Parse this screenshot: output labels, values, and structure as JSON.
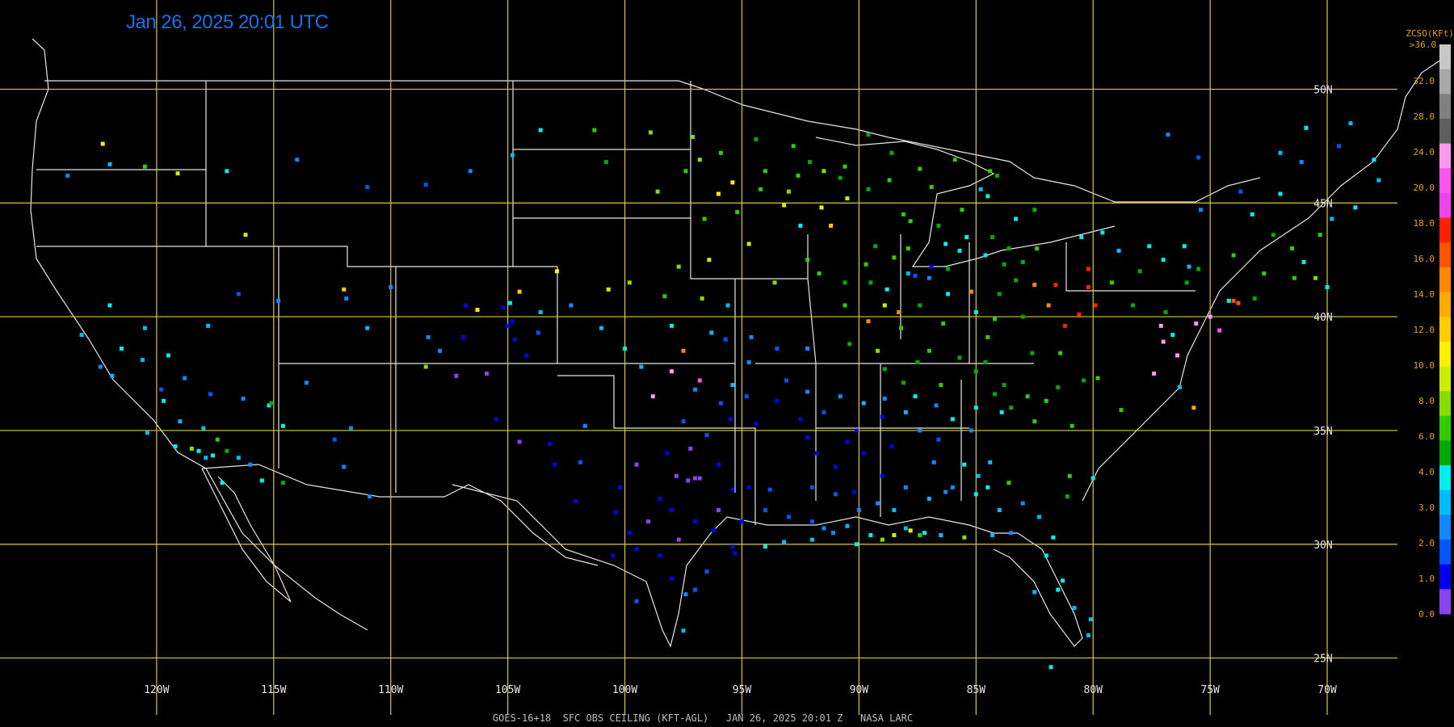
{
  "title": "Jan 26, 2025 20:01 UTC",
  "footer": "GOES-16+18  SFC OBS CEILING (KFT-AGL)   JAN 26, 2025 20:01 Z   NASA LARC",
  "colors": {
    "grid": "#d4c84a",
    "coast": "#e6e6e6",
    "title": "#1e6ee6",
    "legend_text": "#e0a020"
  },
  "map": {
    "lon_min": -126,
    "lon_max": -67,
    "lat_min": 22.5,
    "lat_max": 52.5,
    "grid_lons": [
      -120,
      -115,
      -110,
      -105,
      -100,
      -95,
      -90,
      -85,
      -80,
      -75,
      -70
    ],
    "grid_lats": [
      25,
      30,
      35,
      40,
      45,
      50
    ],
    "lon_labels": [
      "120W",
      "115W",
      "110W",
      "105W",
      "100W",
      "95W",
      "90W",
      "85W",
      "80W",
      "75W",
      "70W"
    ],
    "lat_labels": [
      "25N",
      "30N",
      "35N",
      "40N",
      "45N",
      "50N"
    ]
  },
  "legend": {
    "title": "ZCSO(KFt)",
    "top_label": ">36.0",
    "labels": [
      "32.0",
      "28.0",
      "24.0",
      "20.0",
      "18.0",
      "16.0",
      "14.0",
      "12.0",
      "10.0",
      "8.0",
      "6.0",
      "4.0",
      "3.0",
      "2.0",
      "1.0",
      "0.0"
    ],
    "colors": [
      "#c8c8c8",
      "#a8a8a8",
      "#808080",
      "#606060",
      "#ff99ee",
      "#ff55ee",
      "#ee44ee",
      "#ff2200",
      "#ff5500",
      "#ff8800",
      "#ffaa00",
      "#ffcc00",
      "#ffee00",
      "#ccee00",
      "#88dd00",
      "#33cc00",
      "#00aa00",
      "#00eeee",
      "#00bbff",
      "#1188ff",
      "#0055ff",
      "#0000ee",
      "#8844ee"
    ]
  },
  "stations": [
    [
      -122.3,
      47.6,
      12
    ],
    [
      -116.2,
      43.6,
      13
    ],
    [
      -121.5,
      38.6,
      17
    ],
    [
      -120.6,
      38.1,
      18
    ],
    [
      -121.9,
      37.4,
      18
    ],
    [
      -122.4,
      37.8,
      19
    ],
    [
      -118.2,
      34.1,
      17
    ],
    [
      -117.9,
      33.8,
      18
    ],
    [
      -117.2,
      32.7,
      17
    ],
    [
      -119.8,
      36.8,
      20
    ],
    [
      -119.2,
      34.3,
      17
    ],
    [
      -120.4,
      34.9,
      18
    ],
    [
      -115.2,
      36.1,
      17
    ],
    [
      -115.1,
      36.2,
      16
    ],
    [
      -114.6,
      35.2,
      17
    ],
    [
      -117.0,
      34.1,
      16
    ],
    [
      -116.5,
      33.8,
      18
    ],
    [
      -117.4,
      34.6,
      15
    ],
    [
      -118.5,
      34.2,
      14
    ],
    [
      -119.7,
      36.3,
      17
    ],
    [
      -111.9,
      40.8,
      19
    ],
    [
      -111.0,
      39.5,
      18
    ],
    [
      -112.0,
      41.2,
      11
    ],
    [
      -110.0,
      41.3,
      19
    ],
    [
      -104.8,
      39.8,
      21
    ],
    [
      -105.0,
      39.6,
      21
    ],
    [
      -104.7,
      39.0,
      21
    ],
    [
      -105.2,
      40.4,
      21
    ],
    [
      -104.9,
      40.6,
      17
    ],
    [
      -103.6,
      40.2,
      18
    ],
    [
      -106.9,
      39.1,
      21
    ],
    [
      -107.9,
      38.5,
      19
    ],
    [
      -108.5,
      37.8,
      14
    ],
    [
      -106.3,
      40.3,
      12
    ],
    [
      -104.5,
      41.1,
      11
    ],
    [
      -102.9,
      42.0,
      12
    ],
    [
      -100.7,
      41.2,
      13
    ],
    [
      -99.8,
      41.5,
      14
    ],
    [
      -98.3,
      40.9,
      15
    ],
    [
      -96.7,
      40.8,
      14
    ],
    [
      -97.5,
      38.5,
      9
    ],
    [
      -98.0,
      37.6,
      4
    ],
    [
      -96.8,
      37.2,
      5
    ],
    [
      -95.4,
      37.0,
      18
    ],
    [
      -94.6,
      39.1,
      19
    ],
    [
      -93.1,
      37.2,
      20
    ],
    [
      -92.2,
      38.6,
      19
    ],
    [
      -90.4,
      38.8,
      16
    ],
    [
      -89.6,
      39.8,
      9
    ],
    [
      -88.3,
      40.2,
      9
    ],
    [
      -87.9,
      41.9,
      18
    ],
    [
      -87.6,
      41.8,
      20
    ],
    [
      -85.7,
      42.9,
      17
    ],
    [
      -86.2,
      42.1,
      16
    ],
    [
      -83.8,
      42.3,
      16
    ],
    [
      -83.0,
      42.4,
      16
    ],
    [
      -84.6,
      42.7,
      17
    ],
    [
      -85.2,
      41.1,
      9
    ],
    [
      -84.5,
      39.1,
      15
    ],
    [
      -83.0,
      40.0,
      16
    ],
    [
      -81.9,
      40.5,
      9
    ],
    [
      -81.6,
      41.4,
      7
    ],
    [
      -80.2,
      42.1,
      7
    ],
    [
      -78.9,
      42.9,
      18
    ],
    [
      -77.6,
      43.1,
      17
    ],
    [
      -76.1,
      43.1,
      17
    ],
    [
      -75.9,
      42.2,
      18
    ],
    [
      -76.6,
      39.2,
      17
    ],
    [
      -77.0,
      38.9,
      4
    ],
    [
      -77.4,
      37.5,
      4
    ],
    [
      -76.3,
      36.9,
      18
    ],
    [
      -75.7,
      36.0,
      10
    ],
    [
      -78.8,
      35.9,
      15
    ],
    [
      -80.9,
      35.2,
      15
    ],
    [
      -82.5,
      35.4,
      15
    ],
    [
      -84.4,
      33.6,
      18
    ],
    [
      -84.5,
      32.5,
      17
    ],
    [
      -83.6,
      32.7,
      15
    ],
    [
      -81.1,
      32.1,
      16
    ],
    [
      -80.0,
      32.9,
      17
    ],
    [
      -81.7,
      30.3,
      17
    ],
    [
      -82.5,
      27.9,
      18
    ],
    [
      -81.3,
      28.4,
      17
    ],
    [
      -80.2,
      26.0,
      18
    ],
    [
      -80.1,
      26.7,
      18
    ],
    [
      -81.8,
      24.6,
      17
    ],
    [
      -86.8,
      33.6,
      19
    ],
    [
      -86.3,
      32.3,
      19
    ],
    [
      -88.0,
      30.7,
      18
    ],
    [
      -87.2,
      30.5,
      17
    ],
    [
      -90.1,
      30.0,
      17
    ],
    [
      -91.1,
      30.5,
      19
    ],
    [
      -92.0,
      30.2,
      18
    ],
    [
      -93.2,
      30.1,
      18
    ],
    [
      -94.0,
      29.9,
      17
    ],
    [
      -95.3,
      29.6,
      21
    ],
    [
      -95.4,
      29.9,
      21
    ],
    [
      -96.2,
      30.6,
      21
    ],
    [
      -97.7,
      30.2,
      22
    ],
    [
      -98.5,
      29.5,
      21
    ],
    [
      -97.4,
      27.8,
      19
    ],
    [
      -97.5,
      26.2,
      18
    ],
    [
      -99.5,
      27.5,
      20
    ],
    [
      -100.4,
      31.4,
      21
    ],
    [
      -101.9,
      33.6,
      20
    ],
    [
      -101.7,
      35.2,
      19
    ],
    [
      -103.2,
      34.4,
      21
    ],
    [
      -102.1,
      31.9,
      21
    ],
    [
      -97.0,
      32.9,
      22
    ],
    [
      -97.3,
      32.8,
      22
    ],
    [
      -96.8,
      32.9,
      22
    ],
    [
      -95.4,
      32.4,
      21
    ],
    [
      -94.7,
      32.5,
      21
    ],
    [
      -97.5,
      35.4,
      20
    ],
    [
      -95.9,
      36.2,
      20
    ],
    [
      -94.4,
      35.3,
      21
    ],
    [
      -92.2,
      34.7,
      21
    ],
    [
      -90.1,
      35.0,
      21
    ],
    [
      -89.0,
      35.6,
      21
    ],
    [
      -88.6,
      34.3,
      21
    ],
    [
      -90.2,
      32.3,
      21
    ],
    [
      -91.0,
      33.4,
      21
    ],
    [
      -92.0,
      32.5,
      20
    ],
    [
      -93.8,
      32.4,
      20
    ],
    [
      -86.7,
      36.1,
      19
    ],
    [
      -85.2,
      35.0,
      19
    ],
    [
      -83.9,
      35.8,
      17
    ],
    [
      -86.6,
      34.6,
      20
    ],
    [
      -88.1,
      37.1,
      16
    ],
    [
      -87.5,
      38.0,
      16
    ],
    [
      -85.7,
      38.2,
      16
    ],
    [
      -84.6,
      38.0,
      16
    ],
    [
      -86.4,
      39.7,
      15
    ],
    [
      -84.2,
      39.9,
      15
    ],
    [
      -88.9,
      37.7,
      16
    ],
    [
      -89.2,
      38.5,
      14
    ],
    [
      -92.5,
      44.0,
      17
    ],
    [
      -93.2,
      44.9,
      13
    ],
    [
      -94.0,
      46.4,
      15
    ],
    [
      -96.8,
      46.9,
      14
    ],
    [
      -97.1,
      47.9,
      14
    ],
    [
      -95.4,
      45.9,
      12
    ],
    [
      -96.0,
      45.4,
      12
    ],
    [
      -92.1,
      46.8,
      16
    ],
    [
      -90.6,
      46.6,
      15
    ],
    [
      -89.6,
      45.6,
      16
    ],
    [
      -88.1,
      44.5,
      15
    ],
    [
      -87.9,
      43.0,
      15
    ],
    [
      -89.3,
      43.1,
      16
    ],
    [
      -91.2,
      44.0,
      11
    ],
    [
      -91.6,
      44.8,
      12
    ],
    [
      -90.5,
      45.2,
      13
    ],
    [
      -88.7,
      46.0,
      15
    ],
    [
      -87.4,
      46.5,
      15
    ],
    [
      -85.6,
      44.7,
      15
    ],
    [
      -84.8,
      45.6,
      18
    ],
    [
      -84.4,
      46.4,
      15
    ],
    [
      -84.5,
      45.3,
      17
    ],
    [
      -83.6,
      43.0,
      16
    ],
    [
      -86.3,
      43.2,
      17
    ],
    [
      -87.0,
      41.7,
      19
    ],
    [
      -86.9,
      42.2,
      21
    ],
    [
      -82.4,
      43.0,
      15
    ],
    [
      -80.5,
      43.5,
      17
    ],
    [
      -79.6,
      43.7,
      17
    ],
    [
      -74.0,
      40.7,
      8
    ],
    [
      -73.8,
      40.6,
      8
    ],
    [
      -74.2,
      40.7,
      17
    ],
    [
      -73.1,
      40.8,
      16
    ],
    [
      -72.7,
      41.9,
      15
    ],
    [
      -71.0,
      42.4,
      17
    ],
    [
      -71.4,
      41.7,
      15
    ],
    [
      -72.3,
      43.6,
      16
    ],
    [
      -71.5,
      43.0,
      15
    ],
    [
      -70.3,
      43.6,
      15
    ],
    [
      -68.8,
      44.8,
      17
    ],
    [
      -69.8,
      44.3,
      18
    ],
    [
      -73.2,
      44.5,
      17
    ],
    [
      -75.4,
      44.7,
      19
    ],
    [
      -74.0,
      42.7,
      15
    ],
    [
      -75.5,
      42.1,
      16
    ],
    [
      -77.1,
      39.6,
      4
    ],
    [
      -76.4,
      38.3,
      4
    ],
    [
      -79.9,
      40.5,
      7
    ],
    [
      -80.2,
      41.3,
      7
    ],
    [
      -70.5,
      41.7,
      14
    ],
    [
      -70.0,
      41.3,
      17
    ],
    [
      -68.0,
      46.9,
      17
    ],
    [
      -71.1,
      46.8,
      19
    ],
    [
      -73.7,
      45.5,
      20
    ],
    [
      -72.0,
      45.4,
      17
    ],
    [
      -66.0,
      45.3,
      18
    ],
    [
      -67.8,
      46.0,
      18
    ],
    [
      -69.5,
      47.5,
      20
    ],
    [
      -72.0,
      47.2,
      18
    ],
    [
      -75.5,
      47.0,
      20
    ],
    [
      -76.8,
      48.0,
      19
    ],
    [
      -69.0,
      48.5,
      18
    ],
    [
      -70.9,
      48.3,
      17
    ],
    [
      -98.0,
      31.5,
      21
    ],
    [
      -99.0,
      31.0,
      22
    ],
    [
      -97.0,
      31.0,
      21
    ],
    [
      -96.0,
      31.5,
      22
    ],
    [
      -98.5,
      32.0,
      21
    ],
    [
      -97.8,
      33.0,
      22
    ],
    [
      -96.0,
      33.5,
      21
    ],
    [
      -95.0,
      31.0,
      21
    ],
    [
      -94.0,
      31.5,
      20
    ],
    [
      -93.0,
      31.2,
      20
    ],
    [
      -92.0,
      31.0,
      20
    ],
    [
      -91.5,
      30.7,
      19
    ],
    [
      -90.5,
      30.8,
      18
    ],
    [
      -89.5,
      30.4,
      17
    ],
    [
      -89.0,
      30.2,
      14
    ],
    [
      -88.5,
      30.4,
      13
    ],
    [
      -87.8,
      30.6,
      12
    ],
    [
      -87.4,
      30.4,
      15
    ],
    [
      -86.5,
      30.4,
      18
    ],
    [
      -85.5,
      30.3,
      14
    ],
    [
      -84.3,
      30.4,
      18
    ],
    [
      -83.5,
      30.5,
      19
    ],
    [
      -82.0,
      29.5,
      17
    ],
    [
      -81.5,
      28.0,
      17
    ],
    [
      -80.8,
      27.2,
      18
    ],
    [
      -100.5,
      29.5,
      21
    ],
    [
      -99.5,
      29.8,
      21
    ],
    [
      -98.0,
      28.5,
      21
    ],
    [
      -97.0,
      28.0,
      20
    ],
    [
      -96.5,
      28.8,
      20
    ],
    [
      -99.8,
      30.5,
      21
    ],
    [
      -100.2,
      32.5,
      21
    ],
    [
      -99.5,
      33.5,
      22
    ],
    [
      -98.2,
      34.0,
      21
    ],
    [
      -97.2,
      34.2,
      22
    ],
    [
      -96.5,
      34.8,
      20
    ],
    [
      -95.5,
      35.5,
      21
    ],
    [
      -94.8,
      36.5,
      20
    ],
    [
      -93.5,
      36.3,
      21
    ],
    [
      -92.5,
      35.5,
      21
    ],
    [
      -91.5,
      35.8,
      20
    ],
    [
      -90.8,
      36.5,
      19
    ],
    [
      -89.8,
      36.2,
      18
    ],
    [
      -88.9,
      36.4,
      19
    ],
    [
      -88.0,
      35.8,
      18
    ],
    [
      -87.4,
      35.0,
      19
    ],
    [
      -86.0,
      35.5,
      17
    ],
    [
      -85.0,
      36.0,
      17
    ],
    [
      -84.2,
      36.6,
      16
    ],
    [
      -83.5,
      36.0,
      16
    ],
    [
      -82.8,
      36.5,
      15
    ],
    [
      -82.0,
      36.3,
      15
    ],
    [
      -81.5,
      36.9,
      16
    ],
    [
      -84.9,
      33.0,
      18
    ],
    [
      -85.5,
      33.5,
      17
    ],
    [
      -86.0,
      32.5,
      19
    ],
    [
      -87.0,
      32.0,
      18
    ],
    [
      -88.0,
      32.5,
      19
    ],
    [
      -89.0,
      33.0,
      21
    ],
    [
      -89.8,
      34.0,
      21
    ],
    [
      -90.5,
      34.5,
      21
    ],
    [
      -91.8,
      34.0,
      21
    ],
    [
      -91.0,
      32.2,
      20
    ],
    [
      -90.0,
      31.5,
      19
    ],
    [
      -89.2,
      31.8,
      19
    ],
    [
      -88.5,
      31.5,
      18
    ],
    [
      -85.0,
      32.2,
      17
    ],
    [
      -84.0,
      31.5,
      18
    ],
    [
      -83.0,
      31.8,
      19
    ],
    [
      -82.3,
      31.2,
      18
    ],
    [
      -81.0,
      33.0,
      15
    ],
    [
      -104.5,
      34.5,
      22
    ],
    [
      -105.5,
      35.5,
      21
    ],
    [
      -103.0,
      33.5,
      21
    ],
    [
      -98.8,
      36.5,
      4
    ],
    [
      -97.0,
      36.8,
      19
    ],
    [
      -95.7,
      39.0,
      20
    ],
    [
      -94.7,
      38.0,
      19
    ],
    [
      -93.5,
      38.6,
      20
    ],
    [
      -92.2,
      36.7,
      19
    ],
    [
      -119.0,
      35.4,
      18
    ],
    [
      -117.6,
      33.9,
      17
    ],
    [
      -118.0,
      35.1,
      18
    ],
    [
      -116.0,
      33.5,
      19
    ],
    [
      -115.5,
      32.8,
      17
    ],
    [
      -114.6,
      32.7,
      16
    ],
    [
      -120.5,
      39.5,
      18
    ],
    [
      -119.5,
      38.3,
      17
    ],
    [
      -123.2,
      39.2,
      18
    ],
    [
      -122.0,
      40.5,
      17
    ],
    [
      -117.8,
      39.6,
      18
    ],
    [
      -118.8,
      37.3,
      19
    ],
    [
      -116.5,
      41.0,
      20
    ],
    [
      -114.8,
      40.7,
      19
    ],
    [
      -117.7,
      36.6,
      20
    ],
    [
      -116.3,
      36.4,
      19
    ],
    [
      -113.6,
      37.1,
      19
    ],
    [
      -112.0,
      33.4,
      19
    ],
    [
      -110.9,
      32.1,
      19
    ],
    [
      -112.4,
      34.6,
      20
    ],
    [
      -111.7,
      35.1,
      19
    ],
    [
      -108.4,
      39.1,
      19
    ],
    [
      -106.8,
      40.5,
      21
    ],
    [
      -107.2,
      37.4,
      22
    ],
    [
      -105.9,
      37.5,
      22
    ],
    [
      -104.2,
      38.3,
      21
    ],
    [
      -103.7,
      39.3,
      20
    ],
    [
      -102.3,
      40.5,
      19
    ],
    [
      -101.0,
      39.5,
      18
    ],
    [
      -100.0,
      38.6,
      17
    ],
    [
      -99.3,
      37.8,
      18
    ],
    [
      -98.0,
      39.6,
      17
    ],
    [
      -96.3,
      39.3,
      18
    ],
    [
      -95.6,
      40.5,
      18
    ],
    [
      -97.7,
      42.2,
      14
    ],
    [
      -96.4,
      42.5,
      13
    ],
    [
      -94.7,
      43.2,
      13
    ],
    [
      -93.6,
      41.5,
      14
    ],
    [
      -92.2,
      42.5,
      15
    ],
    [
      -91.7,
      41.9,
      15
    ],
    [
      -90.6,
      41.5,
      16
    ],
    [
      -89.7,
      42.3,
      15
    ],
    [
      -88.8,
      41.2,
      17
    ],
    [
      -87.4,
      40.5,
      16
    ],
    [
      -86.2,
      41.0,
      17
    ],
    [
      -85.0,
      40.2,
      17
    ],
    [
      -84.0,
      41.0,
      16
    ],
    [
      -83.3,
      41.6,
      16
    ],
    [
      -82.5,
      41.4,
      9
    ],
    [
      -81.2,
      39.6,
      7
    ],
    [
      -80.6,
      40.1,
      7
    ],
    [
      -79.2,
      41.5,
      15
    ],
    [
      -78.0,
      42.0,
      16
    ],
    [
      -77.0,
      42.5,
      17
    ],
    [
      -76.0,
      41.5,
      16
    ],
    [
      -75.0,
      40.0,
      4
    ],
    [
      -74.6,
      39.4,
      5
    ],
    [
      -75.6,
      39.7,
      4
    ],
    [
      -76.9,
      40.2,
      16
    ],
    [
      -78.3,
      40.5,
      16
    ],
    [
      -79.8,
      37.3,
      15
    ],
    [
      -80.4,
      37.2,
      16
    ],
    [
      -81.4,
      38.4,
      15
    ],
    [
      -82.6,
      38.4,
      16
    ],
    [
      -83.8,
      37.0,
      16
    ],
    [
      -85.0,
      37.6,
      16
    ],
    [
      -86.5,
      37.0,
      15
    ],
    [
      -87.6,
      36.5,
      17
    ],
    [
      -87.0,
      38.5,
      15
    ],
    [
      -88.2,
      39.5,
      15
    ],
    [
      -88.9,
      40.5,
      13
    ],
    [
      -90.6,
      40.5,
      15
    ],
    [
      -89.5,
      41.5,
      16
    ],
    [
      -88.5,
      42.6,
      15
    ],
    [
      -87.8,
      44.2,
      15
    ],
    [
      -86.6,
      44.0,
      16
    ],
    [
      -85.4,
      43.5,
      17
    ],
    [
      -84.3,
      43.5,
      16
    ],
    [
      -83.3,
      44.3,
      17
    ],
    [
      -82.5,
      44.7,
      16
    ],
    [
      -84.1,
      46.2,
      16
    ],
    [
      -85.9,
      46.9,
      15
    ],
    [
      -86.9,
      45.7,
      15
    ],
    [
      -88.6,
      47.2,
      16
    ],
    [
      -89.6,
      48.0,
      16
    ],
    [
      -90.8,
      46.1,
      16
    ],
    [
      -91.5,
      46.4,
      14
    ],
    [
      -92.8,
      47.5,
      15
    ],
    [
      -94.4,
      47.8,
      16
    ],
    [
      -95.9,
      47.2,
      15
    ],
    [
      -97.4,
      46.4,
      15
    ],
    [
      -98.6,
      45.5,
      14
    ],
    [
      -96.6,
      44.3,
      15
    ],
    [
      -95.2,
      44.6,
      15
    ],
    [
      -94.2,
      45.6,
      15
    ],
    [
      -93.0,
      45.5,
      14
    ],
    [
      -92.6,
      46.2,
      15
    ],
    [
      -123.8,
      46.2,
      19
    ],
    [
      -122.0,
      46.7,
      18
    ],
    [
      -120.5,
      46.6,
      15
    ],
    [
      -119.1,
      46.3,
      13
    ],
    [
      -117.0,
      46.4,
      17
    ],
    [
      -114.0,
      46.9,
      19
    ],
    [
      -111.0,
      45.7,
      20
    ],
    [
      -108.5,
      45.8,
      20
    ],
    [
      -106.6,
      46.4,
      19
    ],
    [
      -104.8,
      47.1,
      18
    ],
    [
      -100.8,
      46.8,
      16
    ],
    [
      -101.3,
      48.2,
      15
    ],
    [
      -98.9,
      48.1,
      14
    ],
    [
      -103.6,
      48.2,
      17
    ]
  ]
}
